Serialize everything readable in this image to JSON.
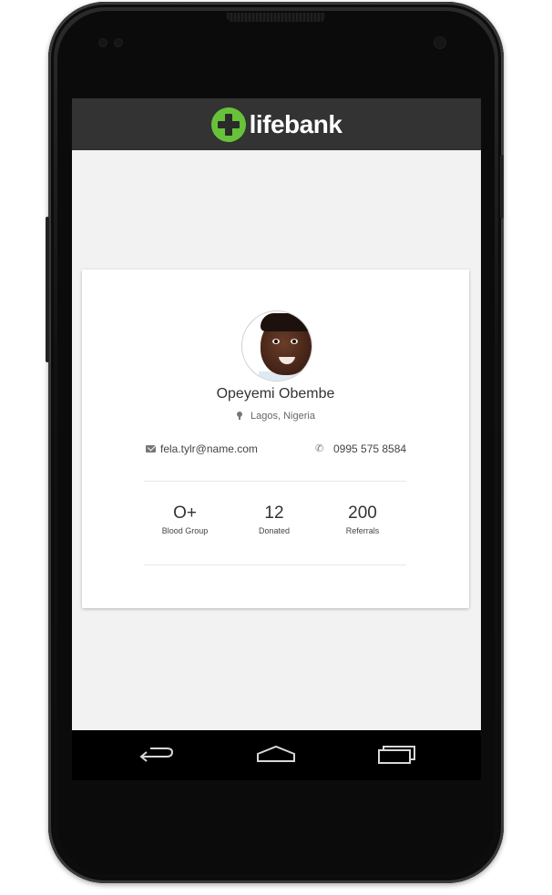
{
  "app": {
    "brand_name": "lifebank",
    "brand_color": "#67c23a",
    "header_color": "#333333"
  },
  "profile": {
    "name": "Opeyemi Obembe",
    "location": "Lagos, Nigeria",
    "email": "fela.tylr@name.com",
    "phone": "0995 575 8584",
    "stats": [
      {
        "value": "O+",
        "label": "Blood Group"
      },
      {
        "value": "12",
        "label": "Donated"
      },
      {
        "value": "200",
        "label": "Referrals"
      }
    ]
  },
  "icons": {
    "logo": "plus-cross-icon",
    "location": "map-pin-icon",
    "email": "envelope-icon",
    "phone": "phone-icon",
    "nav": [
      "back-icon",
      "home-icon",
      "recent-apps-icon"
    ]
  }
}
